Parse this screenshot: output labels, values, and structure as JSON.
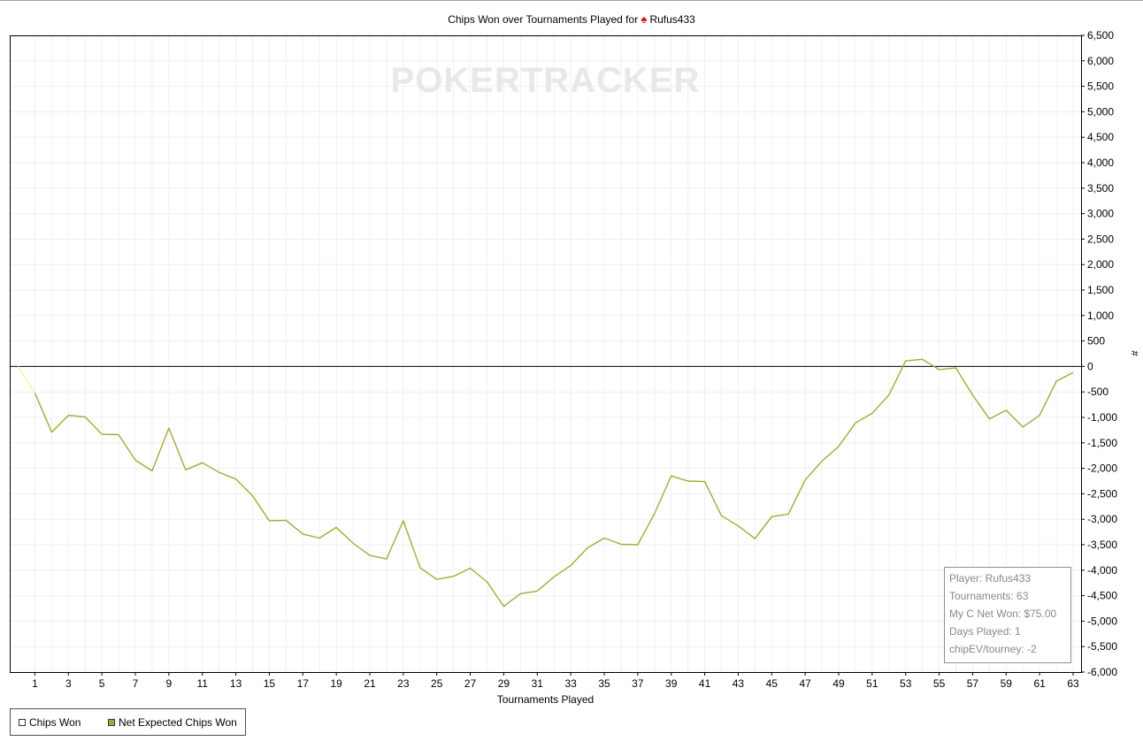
{
  "title": {
    "prefix": "Chips Won over Tournaments Played for",
    "player": "Rufus433"
  },
  "colors": {
    "chips_won": "#ffffff",
    "net_expected": "#a8a838",
    "title_icon": "#cc1111"
  },
  "watermark": "POKERTRACKER",
  "stats": {
    "player": "Player: Rufus433",
    "tournaments": "Tournaments: 63",
    "net_won": "My C Net Won: $75.00",
    "days_played": "Days Played: 1",
    "chip_ev": "chipEV/tourney: -2"
  },
  "legend": {
    "chips_won": "Chips Won",
    "net_expected": "Net Expected Chips Won"
  },
  "chart_data": {
    "type": "line",
    "xlabel": "Tournaments Played",
    "ylabel": "#",
    "xlim": [
      0,
      63
    ],
    "ylim": [
      -6000,
      6500
    ],
    "grid": true,
    "legend_position": "bottom-left",
    "x_ticks": [
      1,
      3,
      5,
      7,
      9,
      11,
      13,
      15,
      17,
      19,
      21,
      23,
      25,
      27,
      29,
      31,
      33,
      35,
      37,
      39,
      41,
      43,
      45,
      47,
      49,
      51,
      53,
      55,
      57,
      59,
      61,
      63
    ],
    "y_ticks": [
      6500,
      6000,
      5500,
      5000,
      4500,
      4000,
      3500,
      3000,
      2500,
      2000,
      1500,
      1000,
      500,
      0,
      -500,
      -1000,
      -1500,
      -2000,
      -2500,
      -3000,
      -3500,
      -4000,
      -4500,
      -5000,
      -5500,
      -6000
    ],
    "y_tick_labels": [
      "6,500",
      "6,000",
      "5,500",
      "5,000",
      "4,500",
      "4,000",
      "3,500",
      "3,000",
      "2,500",
      "2,000",
      "1,500",
      "1,000",
      "500",
      "0",
      "-500",
      "-1,000",
      "-1,500",
      "-2,000",
      "-2,500",
      "-3,000",
      "-3,500",
      "-4,000",
      "-4,500",
      "-5,000",
      "-5,500",
      "-6,000"
    ],
    "series": [
      {
        "name": "Net Expected Chips Won",
        "x": [
          0,
          1,
          2,
          3,
          4,
          5,
          6,
          7,
          8,
          9,
          10,
          11,
          12,
          13,
          14,
          15,
          16,
          17,
          18,
          19,
          20,
          21,
          22,
          23,
          24,
          25,
          26,
          27,
          28,
          29,
          30,
          31,
          32,
          33,
          34,
          35,
          36,
          37,
          38,
          39,
          40,
          41,
          42,
          43,
          44,
          45,
          46,
          47,
          48,
          49,
          50,
          51,
          52,
          53,
          54,
          55,
          56,
          57,
          58,
          59,
          60,
          61,
          62,
          63
        ],
        "values": [
          0,
          -520,
          -1290,
          -960,
          -990,
          -1330,
          -1340,
          -1840,
          -2050,
          -1210,
          -2030,
          -1890,
          -2080,
          -2210,
          -2540,
          -3030,
          -3020,
          -3290,
          -3370,
          -3160,
          -3470,
          -3710,
          -3780,
          -3030,
          -3950,
          -4180,
          -4120,
          -3960,
          -4230,
          -4710,
          -4460,
          -4410,
          -4130,
          -3910,
          -3560,
          -3370,
          -3490,
          -3500,
          -2890,
          -2150,
          -2250,
          -2260,
          -2930,
          -3130,
          -3380,
          -2950,
          -2900,
          -2230,
          -1860,
          -1570,
          -1110,
          -920,
          -560,
          110,
          140,
          -60,
          -30,
          -560,
          -1030,
          -860,
          -1190,
          -960,
          -290,
          -120
        ]
      },
      {
        "name": "Chips Won",
        "x": [
          0,
          1
        ],
        "values": [
          0,
          -520
        ]
      }
    ]
  }
}
